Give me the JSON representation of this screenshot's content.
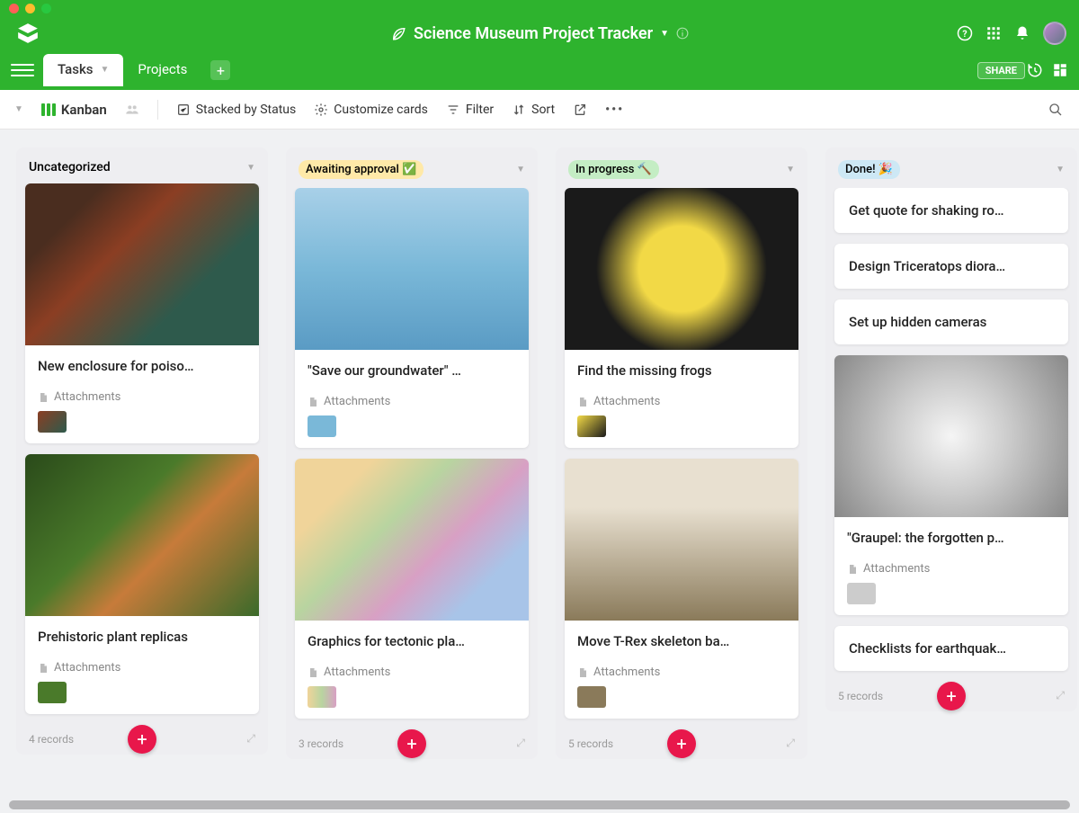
{
  "project_title": "Science Museum Project Tracker",
  "nav": {
    "tabs": [
      {
        "label": "Tasks",
        "active": true
      },
      {
        "label": "Projects",
        "active": false
      }
    ],
    "share": "SHARE"
  },
  "toolbar": {
    "view_name": "Kanban",
    "stacked": "Stacked by Status",
    "customize": "Customize cards",
    "filter": "Filter",
    "sort": "Sort"
  },
  "columns": [
    {
      "title": "Uncategorized",
      "pill": null,
      "footer": "4 records",
      "cards": [
        {
          "title": "New enclosure for poiso…",
          "img": "frog1",
          "attachments": "Attachments"
        },
        {
          "title": "Prehistoric plant replicas",
          "img": "plant",
          "attachments": "Attachments"
        }
      ]
    },
    {
      "title": "Awaiting approval ✅",
      "pill": "yellow",
      "footer": "3 records",
      "cards": [
        {
          "title": "\"Save our groundwater\" …",
          "img": "water",
          "attachments": "Attachments"
        },
        {
          "title": "Graphics for tectonic pla…",
          "img": "map",
          "attachments": "Attachments"
        }
      ]
    },
    {
      "title": "In progress 🔨",
      "pill": "green",
      "footer": "5 records",
      "cards": [
        {
          "title": "Find the missing frogs",
          "img": "frog2",
          "attachments": "Attachments"
        },
        {
          "title": "Move T-Rex skeleton ba…",
          "img": "trex",
          "attachments": "Attachments"
        }
      ]
    },
    {
      "title": "Done! 🎉",
      "pill": "blue",
      "footer": "5 records",
      "simple_cards": [
        {
          "title": "Get quote for shaking ro…"
        },
        {
          "title": "Design Triceratops diora…"
        },
        {
          "title": "Set up hidden cameras"
        }
      ],
      "cards": [
        {
          "title": "\"Graupel: the forgotten p…",
          "img": "graupel",
          "attachments": "Attachments"
        }
      ],
      "trailing_simple": [
        {
          "title": "Checklists for earthquak…"
        }
      ]
    }
  ]
}
